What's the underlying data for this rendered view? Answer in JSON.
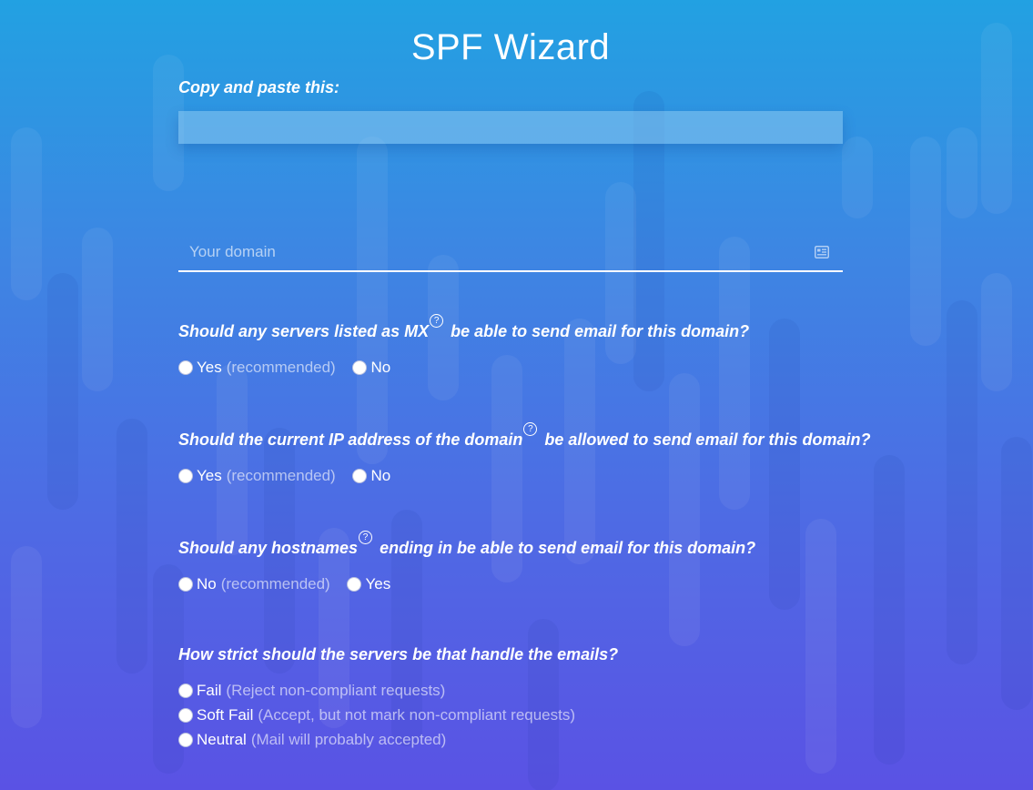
{
  "page": {
    "title": "SPF Wizard",
    "copy_label": "Copy and paste this:",
    "copy_value": ""
  },
  "domain": {
    "placeholder": "Your domain",
    "value": "",
    "icon": "id-card-icon"
  },
  "q_mx": {
    "text_before": "Should any servers listed as MX",
    "text_after": "be able to send email for this domain?",
    "help": "?",
    "options": [
      {
        "label": "Yes",
        "note": "(recommended)"
      },
      {
        "label": "No",
        "note": ""
      }
    ]
  },
  "q_ip": {
    "text_before": "Should the current IP address of the domain",
    "text_after": "be allowed to send email for this domain?",
    "help": "?",
    "options": [
      {
        "label": "Yes",
        "note": "(recommended)"
      },
      {
        "label": "No",
        "note": ""
      }
    ]
  },
  "q_hostnames": {
    "text_before": "Should any hostnames",
    "text_after": "ending in be able to send email for this domain?",
    "help": "?",
    "options": [
      {
        "label": "No",
        "note": "(recommended)"
      },
      {
        "label": "Yes",
        "note": ""
      }
    ]
  },
  "q_strict": {
    "text": "How strict should the servers be that handle the emails?",
    "options": [
      {
        "label": "Fail",
        "note": "(Reject non-compliant requests)"
      },
      {
        "label": "Soft Fail",
        "note": "(Accept, but not mark non-compliant requests)"
      },
      {
        "label": "Neutral",
        "note": "(Mail will probably accepted)"
      }
    ]
  }
}
